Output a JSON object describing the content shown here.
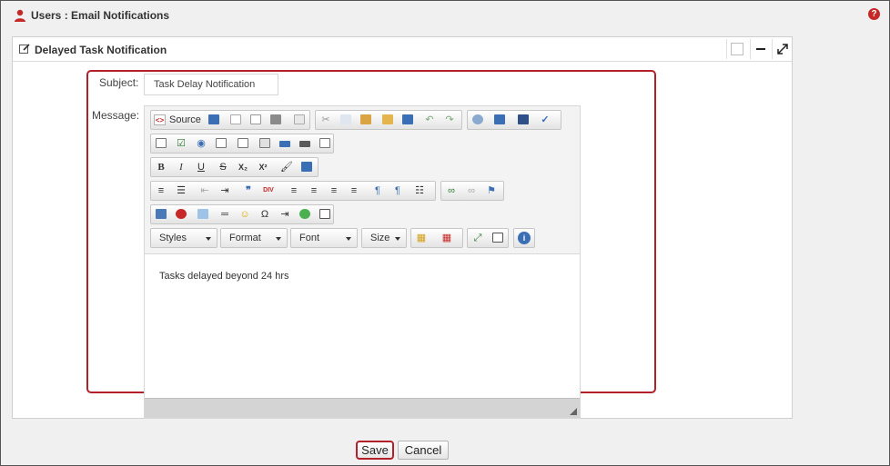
{
  "header": {
    "title": "Users : Email Notifications",
    "help_glyph": "?",
    "user_icon": "user-icon",
    "help_icon": "help-icon"
  },
  "panel": {
    "title": "Delayed Task Notification",
    "edit_icon": "edit-icon",
    "controls": [
      "window-box-icon",
      "minimize-icon",
      "expand-icon"
    ]
  },
  "form": {
    "subject_label": "Subject:",
    "subject_value": "Task Delay Notification",
    "message_label": "Message:"
  },
  "editor": {
    "source_label": "Source",
    "source_glyph": "<>",
    "combos": {
      "styles": "Styles",
      "format": "Format",
      "font": "Font",
      "size": "Size"
    },
    "content": "Tasks delayed beyond 24 hrs",
    "glyphs": {
      "bold": "B",
      "italic": "I",
      "underline": "U",
      "strike": "S",
      "subscript": "X₂",
      "superscript": "X²",
      "omega": "Ω",
      "blockquote": "❞",
      "numbered_list": "≡",
      "bulleted_list": "☰",
      "align_left": "≡",
      "info": "i",
      "undo": "↶",
      "redo": "↷",
      "find": "🔍"
    }
  },
  "colors": {
    "accent_red": "#b3202a",
    "help_red": "#c62828",
    "frame_bg": "#f0f0f0"
  },
  "actions": {
    "save": "Save",
    "cancel": "Cancel"
  }
}
